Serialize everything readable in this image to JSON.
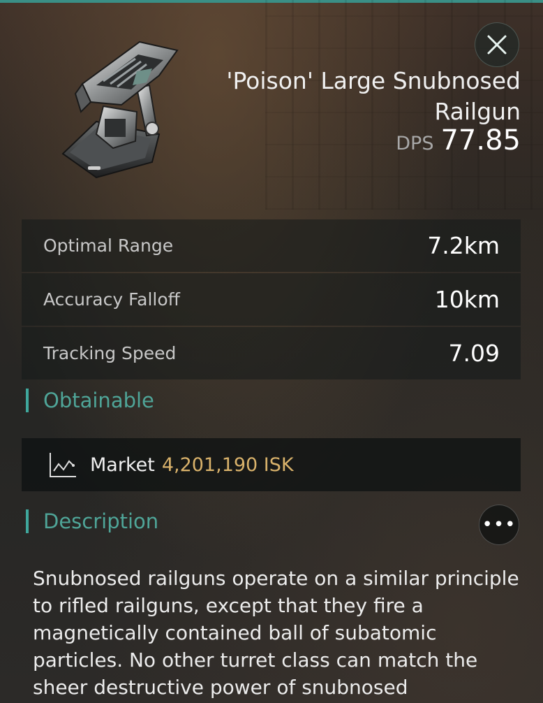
{
  "item": {
    "name": "'Poison' Large Snubnosed Railgun",
    "dps_label": "DPS",
    "dps_value": "77.85",
    "image_icon": "railgun-turret-image"
  },
  "close_icon": "close-x-icon",
  "stats": [
    {
      "label": "Optimal Range",
      "value": "7.2km"
    },
    {
      "label": "Accuracy Falloff",
      "value": "10km"
    },
    {
      "label": "Tracking Speed",
      "value": "7.09"
    }
  ],
  "obtainable": {
    "heading": "Obtainable",
    "market": {
      "icon": "market-chart-icon",
      "label": "Market",
      "value": "4,201,190 ISK"
    }
  },
  "description": {
    "heading": "Description",
    "more_icon": "more-dots-icon",
    "more_glyph": "•••",
    "text": "Snubnosed railguns operate on a similar principle to rifled railguns, except that they fire a magnetically contained ball of subatomic particles. No other turret class can match the sheer destructive power of snubnosed"
  },
  "colors": {
    "accent": "#4fa598",
    "price": "#d9b26b",
    "top_line": "#3a8f86"
  }
}
